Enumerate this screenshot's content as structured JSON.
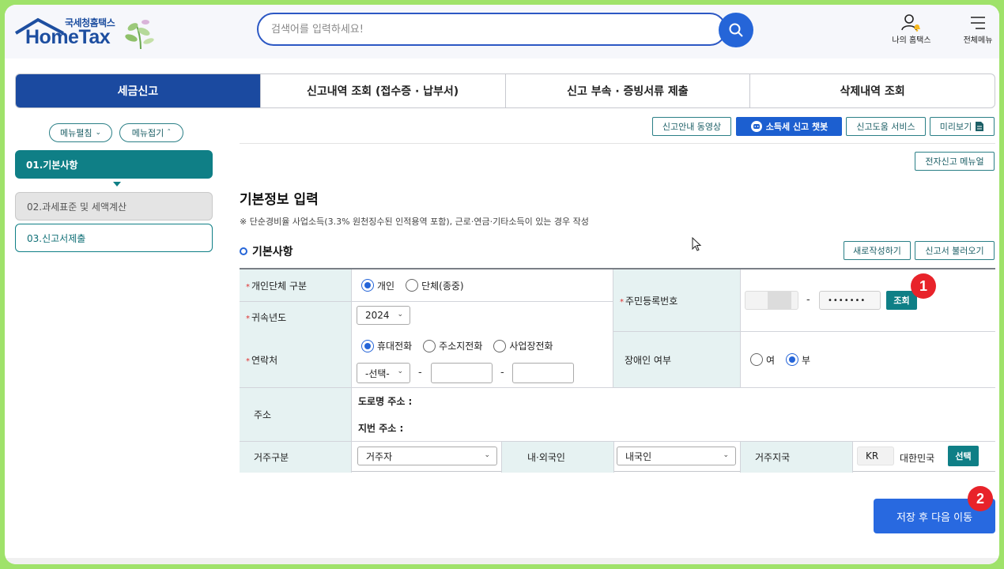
{
  "header": {
    "logo_sub": "국세청홈택스",
    "logo_main": "HomeTax",
    "search_placeholder": "검색어를 입력하세요!",
    "my_hometax": "나의 홈택스",
    "full_menu": "전체메뉴"
  },
  "tabs": [
    "세금신고",
    "신고내역 조회 (접수증 · 납부서)",
    "신고 부속 · 증빙서류 제출",
    "삭제내역 조회"
  ],
  "sidebar": {
    "expand": "메뉴펼침",
    "collapse": "메뉴접기",
    "steps": [
      "01.기본사항",
      "02.과세표준 및 세액계산",
      "03.신고서제출"
    ]
  },
  "toolbar": {
    "guide_video": "신고안내 동영상",
    "chatbot": "소득세 신고 챗봇",
    "help_service": "신고도움 서비스",
    "preview": "미리보기",
    "e_menu": "전자신고 메뉴얼"
  },
  "main": {
    "title": "기본정보 입력",
    "notice": "※ 단순경비율 사업소득(3.3% 원천징수된 인적용역 포함), 근로·연금·기타소득이 있는 경우 작성",
    "section": "기본사항",
    "new_write": "새로작성하기",
    "load_report": "신고서 불러오기"
  },
  "form": {
    "type_label": "개인단체 구분",
    "type_opts": [
      "개인",
      "단체(종중)"
    ],
    "year_label": "귀속년도",
    "year_value": "2024",
    "contact_label": "연락처",
    "contact_opts": [
      "휴대전화",
      "주소지전화",
      "사업장전화"
    ],
    "contact_select": "-선택-",
    "rrn_label": "주민등록번호",
    "rrn_masked": "•••••••",
    "lookup": "조회",
    "disabled_label": "장애인 여부",
    "disabled_opts": [
      "여",
      "부"
    ],
    "address_label": "주소",
    "road_addr": "도로명 주소 :",
    "lot_addr": "지번 주소 :",
    "residence_label": "거주구분",
    "residence_value": "거주자",
    "nationality_label": "내·외국인",
    "nationality_value": "내국인",
    "country_label": "거주지국",
    "country_code": "KR",
    "country_name": "대한민국",
    "select_btn": "선택"
  },
  "dash": "-",
  "badges": [
    "1",
    "2"
  ],
  "save_next": "저장 후 다음 이동",
  "colors": {
    "primary": "#1b4aa0",
    "teal": "#0f7f86",
    "frame": "#9fe26a",
    "badge": "#e8232a"
  }
}
